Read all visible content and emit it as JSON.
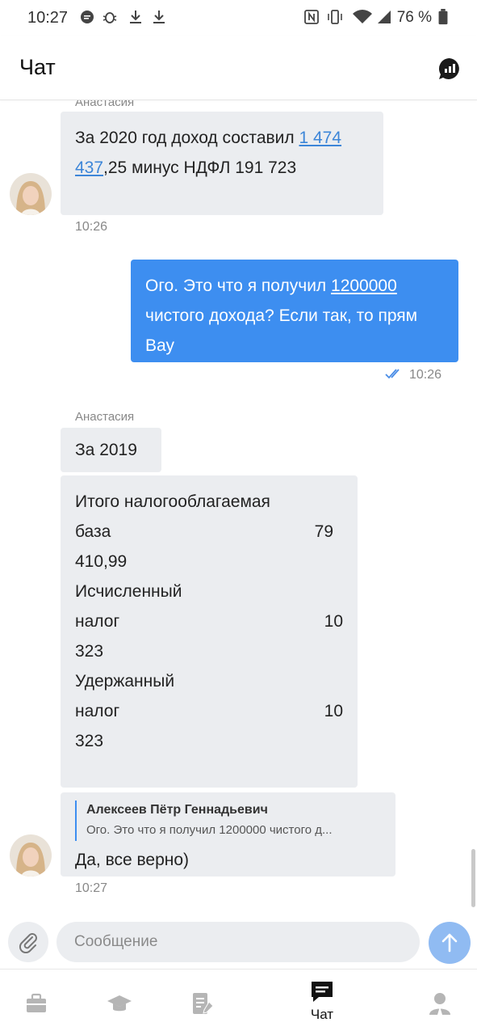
{
  "status_bar": {
    "time": "10:27",
    "battery": "76 %",
    "icons": [
      "message-bubble-icon",
      "bug-icon",
      "download-icon",
      "download-icon",
      "nfc-icon",
      "vibrate-icon",
      "wifi-icon",
      "signal-icon",
      "battery-icon"
    ]
  },
  "header": {
    "title": "Чат",
    "stats_icon": "chat-stats-icon"
  },
  "messages": {
    "m1": {
      "sender": "Анастасия",
      "text_before": "За 2020 год доход составил ",
      "link": "1 474 437",
      "text_after": ",25 минус НДФЛ 191 723",
      "time": "10:26"
    },
    "m2": {
      "text_before": "Ого. Это что я получил ",
      "link": "1200000",
      "text_after": " чистого дохода? Если так, то прям Вау",
      "time": "10:26"
    },
    "m3": {
      "sender": "Анастасия",
      "text": "За 2019"
    },
    "m4": {
      "line1": "Итого налогооблагаемая",
      "row1_label": "база",
      "row1_value": "79",
      "line3": "410,99",
      "line4": "Исчисленный",
      "row2_label": "налог",
      "row2_value": "10",
      "line6": "323",
      "line7": "Удержанный",
      "row3_label": "налог",
      "row3_value": "10",
      "line9": "323"
    },
    "m5": {
      "quote_author": "Алексеев Пётр Геннадьевич",
      "quote_text": "Ого. Это что я получил 1200000 чистого д...",
      "text": "Да, все верно)",
      "time": "10:27"
    }
  },
  "composer": {
    "placeholder": "Сообщение"
  },
  "nav": {
    "items": [
      {
        "icon": "briefcase-icon",
        "label": ""
      },
      {
        "icon": "graduation-cap-icon",
        "label": ""
      },
      {
        "icon": "document-edit-icon",
        "label": ""
      },
      {
        "icon": "chat-icon",
        "label": "Чат",
        "active": true
      },
      {
        "icon": "profile-icon",
        "label": ""
      }
    ]
  },
  "colors": {
    "accent": "#3d8ef0",
    "bubble_in": "#ebedf0",
    "send_button": "#90bbf2"
  }
}
